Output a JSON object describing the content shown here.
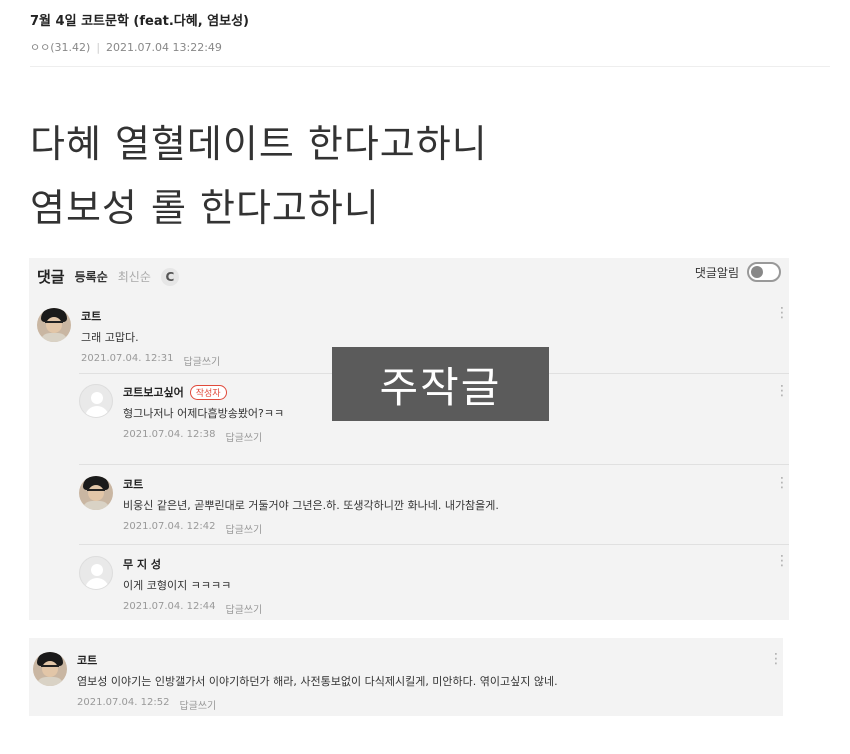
{
  "post": {
    "title": "7월 4일 코트문학 (feat.다혜, 염보성)",
    "author": "ㅇㅇ(31.42)",
    "separator": "|",
    "datetime": "2021.07.04 13:22:49"
  },
  "body": {
    "line1": "다혜 열혈데이트 한다고하니",
    "line2": "염보성 롤 한다고하니"
  },
  "comments_panel": {
    "title": "댓글",
    "sort_registered": "등록순",
    "sort_latest": "최신순",
    "refresh_icon": "refresh-icon",
    "refresh_glyph": "C",
    "alarm_label": "댓글알림"
  },
  "comments": [
    {
      "author": "코트",
      "body": "그래 고맙다.",
      "date": "2021.07.04. 12:31",
      "reply_label": "답글쓰기"
    },
    {
      "author": "코트보고싶어",
      "badge": "작성자",
      "body": "형그나저나 어제다흡방송봤어?ㅋㅋ",
      "date": "2021.07.04. 12:38",
      "reply_label": "답글쓰기"
    },
    {
      "author": "코트",
      "body": "비웅신 같은년, 곧뿌린대로 거둘거야 그년은.하. 또생각하니깐 화나네. 내가참을게.",
      "date": "2021.07.04. 12:42",
      "reply_label": "답글쓰기"
    },
    {
      "author": "무 지 성",
      "body": "이게 코형이지 ㅋㅋㅋㅋ",
      "date": "2021.07.04. 12:44",
      "reply_label": "답글쓰기"
    },
    {
      "author": "코트",
      "body": "염보성 이야기는 인방갤가서 이야기하던가 해라, 사전통보없이 다식제시킬게, 미안하다. 엮이고싶지 않네.",
      "date": "2021.07.04. 12:52",
      "reply_label": "답글쓰기"
    }
  ],
  "overlay_caption": "주작글",
  "more_glyph": "⋮"
}
